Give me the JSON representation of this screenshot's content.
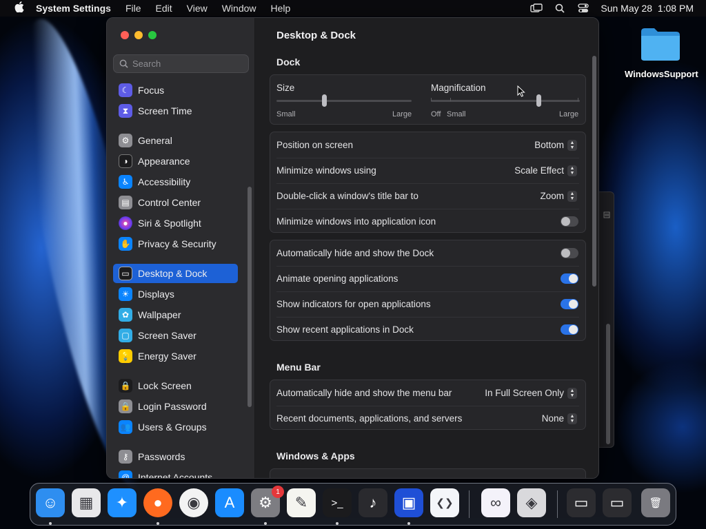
{
  "menubar": {
    "app_name": "System Settings",
    "items": [
      "File",
      "Edit",
      "View",
      "Window",
      "Help"
    ],
    "datetime": "Sun May 28  1:08 PM"
  },
  "desktop": {
    "folder_label": "WindowsSupport"
  },
  "sidebar": {
    "search_placeholder": "Search",
    "items": [
      {
        "label": "Focus",
        "icon": "moon-icon",
        "color": "#5e5ce6"
      },
      {
        "label": "Screen Time",
        "icon": "hourglass-icon",
        "color": "#5e5ce6"
      },
      {
        "label": "General",
        "icon": "gear-icon",
        "color": "#8e8e93"
      },
      {
        "label": "Appearance",
        "icon": "appearance-icon",
        "color": "#1c1c1e"
      },
      {
        "label": "Accessibility",
        "icon": "accessibility-icon",
        "color": "#0a84ff"
      },
      {
        "label": "Control Center",
        "icon": "control-center-icon",
        "color": "#8e8e93"
      },
      {
        "label": "Siri & Spotlight",
        "icon": "siri-icon",
        "color": "#bf5af2"
      },
      {
        "label": "Privacy & Security",
        "icon": "hand-icon",
        "color": "#0a84ff"
      },
      {
        "label": "Desktop & Dock",
        "icon": "dock-icon",
        "color": "#1c1c1e"
      },
      {
        "label": "Displays",
        "icon": "sun-icon",
        "color": "#0a84ff"
      },
      {
        "label": "Wallpaper",
        "icon": "flower-icon",
        "color": "#32ade6"
      },
      {
        "label": "Screen Saver",
        "icon": "screen-saver-icon",
        "color": "#32ade6"
      },
      {
        "label": "Energy Saver",
        "icon": "lightbulb-icon",
        "color": "#ffcc00"
      },
      {
        "label": "Lock Screen",
        "icon": "lock-icon",
        "color": "#1c1c1e"
      },
      {
        "label": "Login Password",
        "icon": "lock-icon",
        "color": "#8e8e93"
      },
      {
        "label": "Users & Groups",
        "icon": "users-icon",
        "color": "#0a84ff"
      },
      {
        "label": "Passwords",
        "icon": "key-icon",
        "color": "#8e8e93"
      },
      {
        "label": "Internet Accounts",
        "icon": "at-icon",
        "color": "#0a84ff"
      }
    ]
  },
  "main": {
    "title": "Desktop & Dock",
    "dock_section": "Dock",
    "size_label": "Size",
    "size_small": "Small",
    "size_large": "Large",
    "size_value": 0.35,
    "magnification_label": "Magnification",
    "mag_off": "Off",
    "mag_small": "Small",
    "mag_large": "Large",
    "magnification_value": 0.72,
    "position_label": "Position on screen",
    "position_value": "Bottom",
    "minimize_label": "Minimize windows using",
    "minimize_value": "Scale Effect",
    "doubleclick_label": "Double-click a window's title bar to",
    "doubleclick_value": "Zoom",
    "minimize_into_icon_label": "Minimize windows into application icon",
    "minimize_into_icon": false,
    "autohide_label": "Automatically hide and show the Dock",
    "autohide": false,
    "animate_label": "Animate opening applications",
    "animate": true,
    "indicators_label": "Show indicators for open applications",
    "indicators": true,
    "recent_label": "Show recent applications in Dock",
    "recent": true,
    "menubar_section": "Menu Bar",
    "menubar_autohide_label": "Automatically hide and show the menu bar",
    "menubar_autohide_value": "In Full Screen Only",
    "recent_docs_label": "Recent documents, applications, and servers",
    "recent_docs_value": "None",
    "windows_section": "Windows & Apps"
  },
  "dock": {
    "badge_count": "1",
    "apps": [
      {
        "name": "finder-icon",
        "color": "#2e8ef0",
        "glyph": "☺"
      },
      {
        "name": "launchpad-icon",
        "color": "#e8e8ea",
        "glyph": "▦"
      },
      {
        "name": "safari-icon",
        "color": "#1e90ff",
        "glyph": "✦"
      },
      {
        "name": "firefox-icon",
        "color": "#ff6a1f",
        "glyph": "●"
      },
      {
        "name": "chrome-icon",
        "color": "#f3f3f3",
        "glyph": "◉"
      },
      {
        "name": "app-store-icon",
        "color": "#1a8cff",
        "glyph": "A"
      },
      {
        "name": "system-settings-icon",
        "color": "#7d7d82",
        "glyph": "⚙"
      },
      {
        "name": "textedit-icon",
        "color": "#f5f5f0",
        "glyph": "✎"
      },
      {
        "name": "terminal-icon",
        "color": "#1b1b1d",
        "glyph": ">_"
      },
      {
        "name": "garageband-icon",
        "color": "#2a2a2e",
        "glyph": "♪"
      },
      {
        "name": "virtual-machine-icon",
        "color": "#1f4fd6",
        "glyph": "▣"
      },
      {
        "name": "vscode-icon",
        "color": "#f4f6fa",
        "glyph": "❮❯"
      },
      {
        "name": "visual-studio-icon",
        "color": "#f4f2fa",
        "glyph": "∞"
      },
      {
        "name": "bootcamp-icon",
        "color": "#d9d9dc",
        "glyph": "◈"
      },
      {
        "name": "minimized-window-icon",
        "color": "#2c2c30",
        "glyph": "▭"
      },
      {
        "name": "minimized-window-icon",
        "color": "#2c2c30",
        "glyph": "▭"
      },
      {
        "name": "trash-icon",
        "color": "#7a7a80",
        "glyph": "🗑"
      }
    ]
  }
}
